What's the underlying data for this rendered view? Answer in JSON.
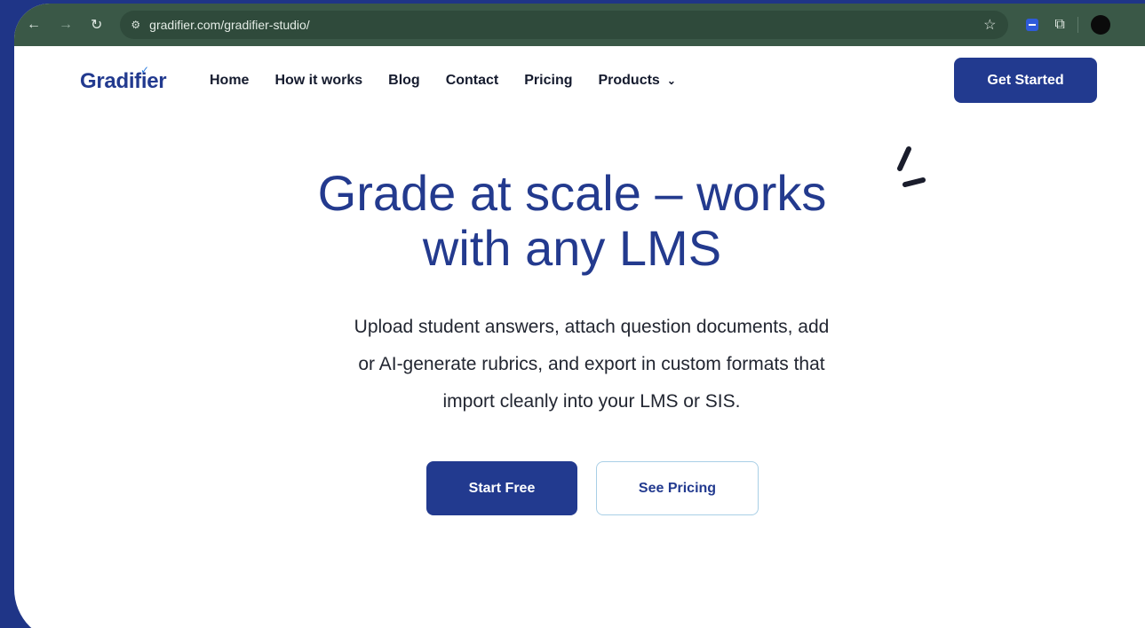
{
  "browser": {
    "url": "gradifier.com/gradifier-studio/"
  },
  "header": {
    "logo_text": "Gradifier",
    "nav": [
      {
        "label": "Home"
      },
      {
        "label": "How it works"
      },
      {
        "label": "Blog"
      },
      {
        "label": "Contact"
      },
      {
        "label": "Pricing"
      },
      {
        "label": "Products"
      }
    ],
    "cta_label": "Get Started"
  },
  "hero": {
    "title_line1": "Grade at scale – works",
    "title_line2": "with any LMS",
    "subtitle_line1": "Upload student answers, attach question documents, add",
    "subtitle_line2": "or AI-generate rubrics, and export in custom formats that",
    "subtitle_line3": "import cleanly into your LMS or SIS.",
    "primary_button": "Start Free",
    "secondary_button": "See Pricing"
  },
  "colors": {
    "brand": "#223a8f",
    "background": "#1f3587",
    "browser_bar": "#3a5847"
  }
}
